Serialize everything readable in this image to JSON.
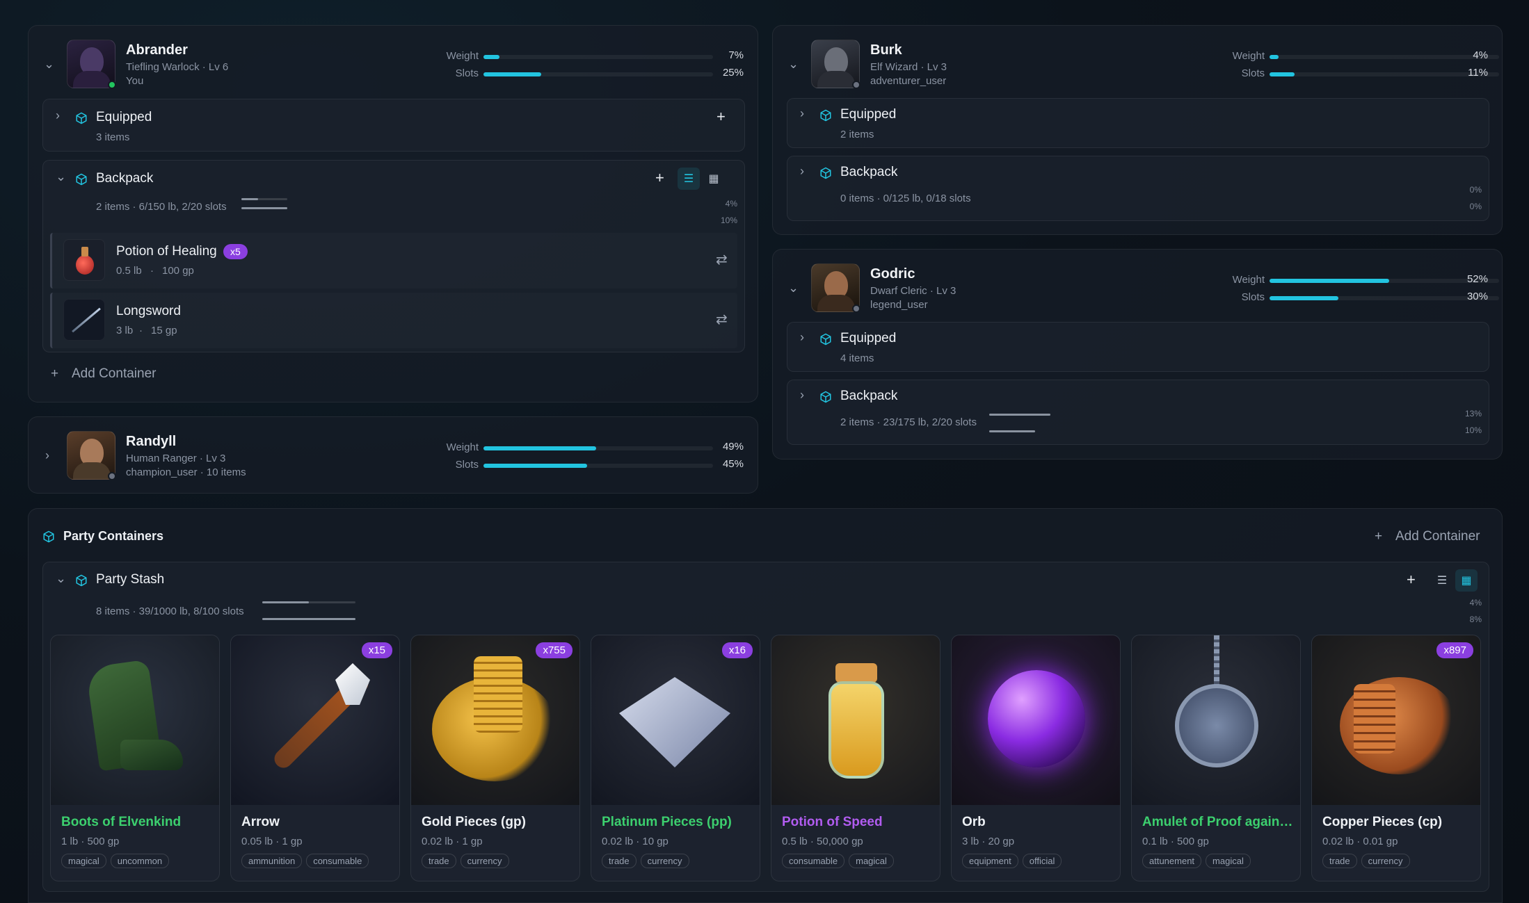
{
  "characters": [
    {
      "name": "Abrander",
      "race_class": "Tiefling Warlock · Lv 6",
      "owner": "You",
      "weight_label": "Weight",
      "weight_pct": "7%",
      "weight_frac": 0.07,
      "slots_label": "Slots",
      "slots_pct": "25%",
      "slots_frac": 0.25,
      "status_color": "#22c55e",
      "containers": [
        {
          "title": "Equipped",
          "summary": "3 items",
          "add_icon": "plus-icon"
        },
        {
          "title": "Backpack",
          "summary": "2 items · 6/150 lb, 2/20 slots",
          "weight_pct": "4%",
          "slots_pct": "10%",
          "weight_frac": 0.04,
          "slots_frac": 0.1,
          "items": [
            {
              "name": "Potion of Healing",
              "qty": "x5",
              "weight": "0.5 lb",
              "value": "100 gp"
            },
            {
              "name": "Longsword",
              "weight": "3 lb",
              "value": "15 gp"
            }
          ]
        }
      ],
      "add_container": "Add Container"
    },
    {
      "name": "Randyll",
      "race_class": "Human Ranger · Lv 3",
      "owner": "champion_user · 10 items",
      "weight_label": "Weight",
      "weight_pct": "49%",
      "weight_frac": 0.49,
      "slots_label": "Slots",
      "slots_pct": "45%",
      "slots_frac": 0.45,
      "status_color": "#6b7280"
    },
    {
      "name": "Burk",
      "race_class": "Elf Wizard · Lv 3",
      "owner": "adventurer_user",
      "weight_label": "Weight",
      "weight_pct": "4%",
      "weight_frac": 0.04,
      "slots_label": "Slots",
      "slots_pct": "11%",
      "slots_frac": 0.11,
      "status_color": "#6b7280",
      "containers": [
        {
          "title": "Equipped",
          "summary": "2 items"
        },
        {
          "title": "Backpack",
          "summary": "0 items · 0/125 lb, 0/18 slots",
          "weight_pct": "0%",
          "slots_pct": "0%"
        }
      ]
    },
    {
      "name": "Godric",
      "race_class": "Dwarf Cleric · Lv 3",
      "owner": "legend_user",
      "weight_label": "Weight",
      "weight_pct": "52%",
      "weight_frac": 0.52,
      "slots_label": "Slots",
      "slots_pct": "30%",
      "slots_frac": 0.3,
      "status_color": "#6b7280",
      "containers": [
        {
          "title": "Equipped",
          "summary": "4 items"
        },
        {
          "title": "Backpack",
          "summary": "2 items · 23/175 lb, 2/20 slots",
          "weight_pct": "13%",
          "slots_pct": "10%",
          "weight_frac": 0.13,
          "slots_frac": 0.1
        }
      ]
    }
  ],
  "party": {
    "title": "Party Containers",
    "add_container": "Add Container",
    "stash": {
      "title": "Party Stash",
      "summary": "8 items · 39/1000 lb, 8/100 slots",
      "weight_pct": "4%",
      "slots_pct": "8%",
      "weight_frac": 0.04,
      "slots_frac": 0.08,
      "items": [
        {
          "name": "Boots of Elvenkind",
          "meta": "1 lb · 500 gp",
          "tags": [
            "magical",
            "uncommon"
          ],
          "qty": "",
          "color": "#3ccf6e",
          "art": "boots"
        },
        {
          "name": "Arrow",
          "meta": "0.05 lb · 1 gp",
          "tags": [
            "ammunition",
            "consumable"
          ],
          "qty": "x15",
          "color": "#eef1f5",
          "art": "arrow"
        },
        {
          "name": "Gold Pieces (gp)",
          "meta": "0.02 lb · 1 gp",
          "tags": [
            "trade",
            "currency"
          ],
          "qty": "x755",
          "color": "#eef1f5",
          "art": "gold"
        },
        {
          "name": "Platinum Pieces (pp)",
          "meta": "0.02 lb · 10 gp",
          "tags": [
            "trade",
            "currency"
          ],
          "qty": "x16",
          "color": "#3ccf6e",
          "art": "platinum"
        },
        {
          "name": "Potion of Speed",
          "meta": "0.5 lb · 50,000 gp",
          "tags": [
            "consumable",
            "magical"
          ],
          "qty": "",
          "color": "#b15cf0",
          "art": "potion"
        },
        {
          "name": "Orb",
          "meta": "3 lb · 20 gp",
          "tags": [
            "equipment",
            "official"
          ],
          "qty": "",
          "color": "#eef1f5",
          "art": "orb"
        },
        {
          "name": "Amulet of Proof against Detection and Location",
          "meta": "0.1 lb · 500 gp",
          "tags": [
            "attunement",
            "magical"
          ],
          "qty": "",
          "color": "#3ccf6e",
          "art": "amulet"
        },
        {
          "name": "Copper Pieces (cp)",
          "meta": "0.02 lb · 0.01 gp",
          "tags": [
            "trade",
            "currency"
          ],
          "qty": "x897",
          "color": "#eef1f5",
          "art": "copper"
        }
      ]
    }
  },
  "colors": {
    "accent": "#22c4e0",
    "qty_badge": "#8b3fe0",
    "rare": "#3ccf6e",
    "very_rare": "#b15cf0"
  }
}
